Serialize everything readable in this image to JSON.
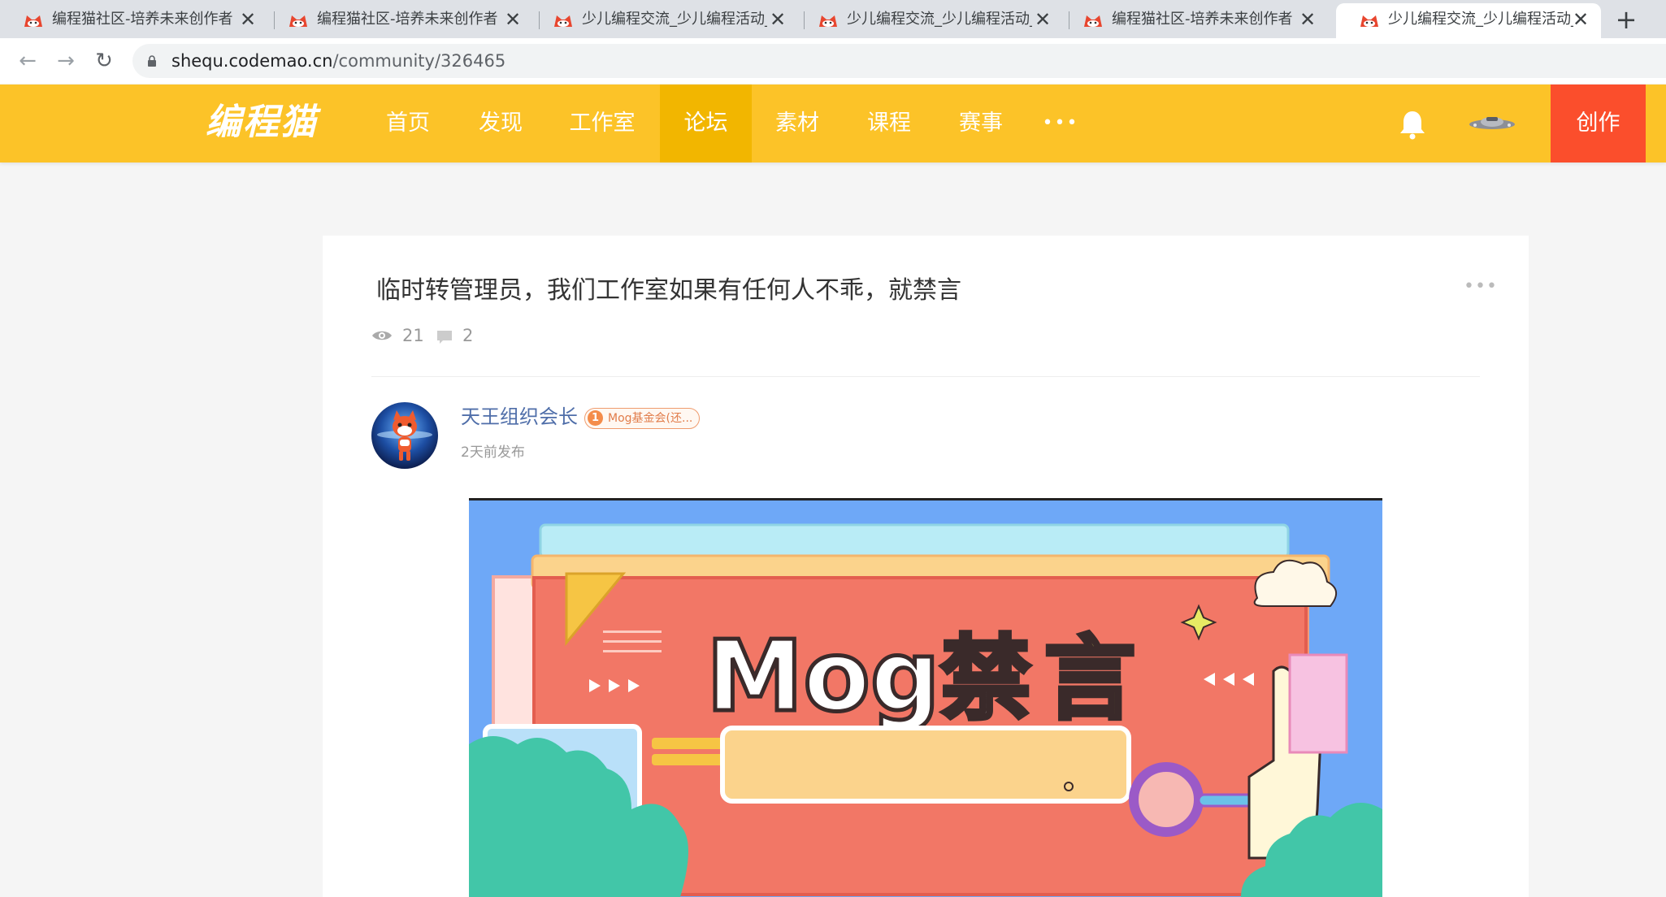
{
  "browser": {
    "tabs": [
      {
        "title": "编程猫社区-培养未来创作者",
        "active": false
      },
      {
        "title": "编程猫社区-培养未来创作者",
        "active": false
      },
      {
        "title": "少儿编程交流_少儿编程活动_",
        "active": false
      },
      {
        "title": "少儿编程交流_少儿编程活动_",
        "active": false
      },
      {
        "title": "编程猫社区-培养未来创作者",
        "active": false
      },
      {
        "title": "少儿编程交流_少儿编程活动_",
        "active": true
      }
    ],
    "close_glyph": "✕",
    "new_tab_glyph": "+",
    "back_glyph": "←",
    "forward_glyph": "→",
    "reload_glyph": "↻",
    "url_host": "shequ.codemao.cn",
    "url_path": "/community/326465"
  },
  "site": {
    "logo": "编程猫",
    "nav": [
      {
        "label": "首页",
        "active": false
      },
      {
        "label": "发现",
        "active": false
      },
      {
        "label": "工作室",
        "active": false
      },
      {
        "label": "论坛",
        "active": true
      },
      {
        "label": "素材",
        "active": false
      },
      {
        "label": "课程",
        "active": false
      },
      {
        "label": "赛事",
        "active": false
      }
    ],
    "more": "•••",
    "create_label": "创作",
    "colors": {
      "header": "#fcc328",
      "active_nav": "#f2b600",
      "create": "#fb4e2c"
    }
  },
  "post": {
    "title": "临时转管理员，我们工作室如果有任何人不乖，就禁言",
    "more": "•••",
    "views": "21",
    "comments": "2",
    "author": "天王组织会长",
    "badge_level": "1",
    "badge_text": "Mog基金会(还...",
    "time": "2天前发布",
    "image": {
      "text_en": "Mog",
      "text_cn": "禁言"
    }
  }
}
